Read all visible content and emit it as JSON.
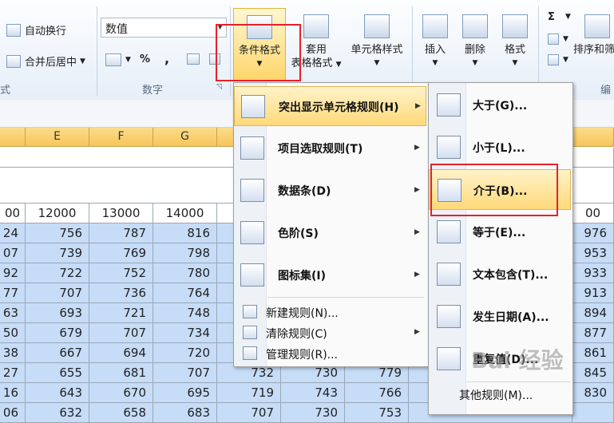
{
  "ribbon": {
    "wrap_text": "自动换行",
    "merge_center": "合并后居中",
    "number_format_value": "数值",
    "percent": "%",
    "comma": ",",
    "number_group_label": "数字",
    "conditional_format": "条件格式",
    "table_format_line1": "套用",
    "table_format_line2": "表格格式",
    "cell_styles": "单元格样式",
    "insert": "插入",
    "delete": "删除",
    "format": "格式",
    "sort_filter": "排序和筛",
    "sigma": "Σ",
    "left_cut": "式",
    "right_cut": "编"
  },
  "sheet": {
    "columns": [
      "E",
      "F",
      "G"
    ],
    "header_row": [
      "00",
      "12000",
      "13000",
      "14000"
    ],
    "header_right": "00",
    "rows": [
      [
        "24",
        "756",
        "787",
        "816"
      ],
      [
        "07",
        "739",
        "769",
        "798"
      ],
      [
        "92",
        "722",
        "752",
        "780"
      ],
      [
        "77",
        "707",
        "736",
        "764"
      ],
      [
        "63",
        "693",
        "721",
        "748"
      ],
      [
        "50",
        "679",
        "707",
        "734"
      ],
      [
        "38",
        "667",
        "694",
        "720"
      ],
      [
        "27",
        "655",
        "681",
        "707"
      ],
      [
        "16",
        "643",
        "670",
        "695"
      ],
      [
        "06",
        "632",
        "658",
        "683"
      ]
    ],
    "right_col": [
      "976",
      "953",
      "933",
      "913",
      "894",
      "877",
      "861",
      "845",
      "830",
      ""
    ],
    "hidden_row_tail": [
      [
        "719",
        "743",
        "766"
      ],
      [
        "707",
        "730",
        "753"
      ]
    ],
    "partial_row8": [
      "732",
      "730",
      "779"
    ]
  },
  "main_menu": {
    "items": [
      {
        "label": "突出显示单元格规则(H)",
        "icon": "highlight-rules-icon"
      },
      {
        "label": "项目选取规则(T)",
        "icon": "top-bottom-rules-icon"
      },
      {
        "label": "数据条(D)",
        "icon": "data-bars-icon"
      },
      {
        "label": "色阶(S)",
        "icon": "color-scales-icon"
      },
      {
        "label": "图标集(I)",
        "icon": "icon-sets-icon"
      }
    ],
    "small_items": [
      {
        "label": "新建规则(N)...",
        "icon": "new-rule-icon"
      },
      {
        "label": "清除规则(C)",
        "icon": "clear-rules-icon"
      },
      {
        "label": "管理规则(R)...",
        "icon": "manage-rules-icon"
      }
    ]
  },
  "sub_menu": {
    "items": [
      {
        "label": "大于(G)...",
        "icon": "greater-than-icon"
      },
      {
        "label": "小于(L)...",
        "icon": "less-than-icon"
      },
      {
        "label": "介于(B)...",
        "icon": "between-icon"
      },
      {
        "label": "等于(E)...",
        "icon": "equal-to-icon"
      },
      {
        "label": "文本包含(T)...",
        "icon": "text-contains-icon"
      },
      {
        "label": "发生日期(A)...",
        "icon": "date-occurring-icon"
      },
      {
        "label": "重复值(D)...",
        "icon": "duplicate-values-icon"
      }
    ],
    "more": "其他规则(M)..."
  },
  "watermark": "Bai 经验",
  "colors": {
    "highlight": "#ffd97a",
    "selection": "#c6dcf7",
    "red_box": "#e8202a"
  }
}
